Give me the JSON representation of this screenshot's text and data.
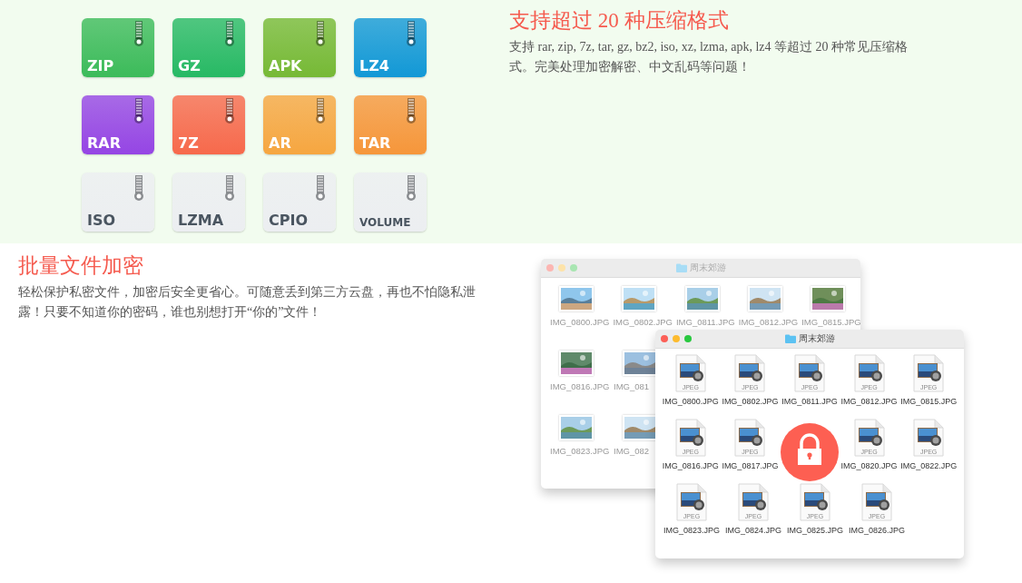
{
  "formats": [
    {
      "label": "ZIP",
      "color": "#3cbb5a"
    },
    {
      "label": "GZ",
      "color": "#27b964"
    },
    {
      "label": "APK",
      "color": "#76b935"
    },
    {
      "label": "LZ4",
      "color": "#1298d6"
    },
    {
      "label": "RAR",
      "color": "#9545e4"
    },
    {
      "label": "7Z",
      "color": "#f7694c"
    },
    {
      "label": "AR",
      "color": "#f6a640"
    },
    {
      "label": "TAR",
      "color": "#f6963a"
    },
    {
      "label": "ISO",
      "color": "#eceef1"
    },
    {
      "label": "LZMA",
      "color": "#eceef1"
    },
    {
      "label": "CPIO",
      "color": "#eceef1"
    },
    {
      "label": "VOLUME",
      "color": "#eceef1"
    }
  ],
  "formats_section": {
    "title": "支持超过 20 种压缩格式",
    "text": "支持 rar, zip, 7z, tar, gz, bz2, iso, xz, lzma, apk, lz4 等超过 20 种常见压缩格式。完美处理加密解密、中文乱码等问题！"
  },
  "encrypt_section": {
    "title": "批量文件加密",
    "text": "轻松保护私密文件，加密后安全更省心。可随意丢到第三方云盘，再也不怕隐私泄露！只要不知道你的密码，谁也别想打开“你的”文件！"
  },
  "windows": [
    {
      "title": "周末郊游",
      "active": false,
      "rows": [
        [
          {
            "label": "IMG_0800.JPG"
          },
          {
            "label": "IMG_0802.JPG"
          },
          {
            "label": "IMG_0811.JPG"
          },
          {
            "label": "IMG_0812.JPG"
          },
          {
            "label": "IMG_0815.JPG"
          }
        ],
        [
          {
            "label": "IMG_0816.JPG"
          },
          {
            "label": "IMG_081"
          }
        ],
        [
          {
            "label": "IMG_0823.JPG"
          },
          {
            "label": "IMG_082"
          }
        ]
      ]
    },
    {
      "title": "周末郊游",
      "active": true,
      "rows": [
        [
          {
            "kind": "file",
            "badge": "JPEG",
            "label": "IMG_0800.JPG"
          },
          {
            "kind": "file",
            "badge": "JPEG",
            "label": "IMG_0802.JPG"
          },
          {
            "kind": "file",
            "badge": "JPEG",
            "label": "IMG_0811.JPG"
          },
          {
            "kind": "file",
            "badge": "JPEG",
            "label": "IMG_0812.JPG"
          },
          {
            "kind": "file",
            "badge": "JPEG",
            "label": "IMG_0815.JPG"
          }
        ],
        [
          {
            "kind": "file",
            "badge": "JPEG",
            "label": "IMG_0816.JPG"
          },
          {
            "kind": "file",
            "badge": "JPEG",
            "label": "IMG_0817.JPG"
          },
          {
            "kind": "lock"
          },
          {
            "kind": "file",
            "badge": "JPEG",
            "label": "IMG_0820.JPG"
          },
          {
            "kind": "file",
            "badge": "JPEG",
            "label": "IMG_0822.JPG"
          }
        ],
        [
          {
            "kind": "file",
            "badge": "JPEG",
            "label": "IMG_0823.JPG"
          },
          {
            "kind": "file",
            "badge": "JPEG",
            "label": "IMG_0824.JPG"
          },
          {
            "kind": "file",
            "badge": "JPEG",
            "label": "IMG_0825.JPG"
          },
          {
            "kind": "file",
            "badge": "JPEG",
            "label": "IMG_0826.JPG"
          }
        ]
      ]
    }
  ]
}
